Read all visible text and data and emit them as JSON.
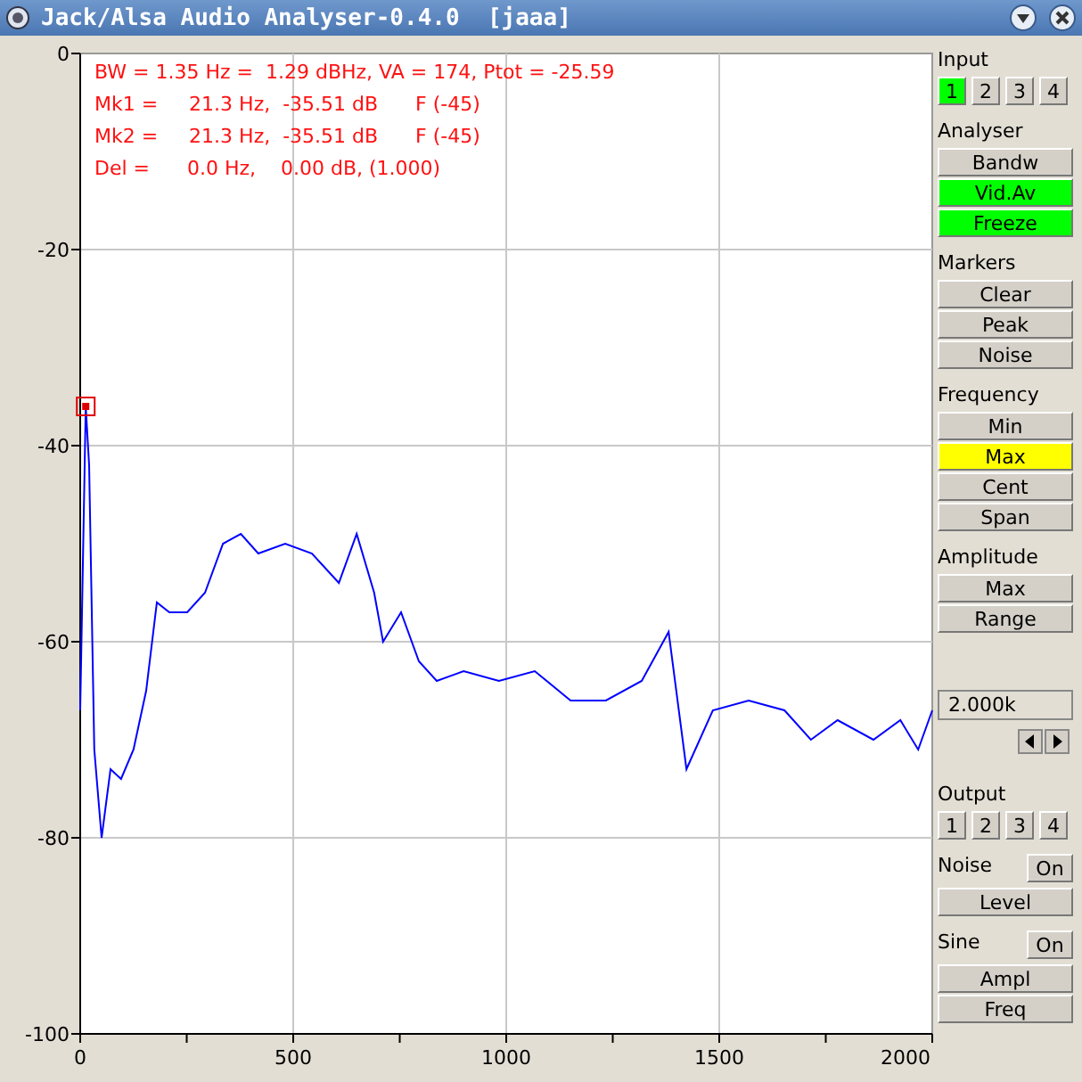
{
  "window": {
    "title": "Jack/Alsa Audio Analyser-0.4.0  [jaaa]"
  },
  "readouts": [
    "BW = 1.35 Hz =  1.29 dBHz, VA = 174, Ptot = -25.59",
    "Mk1 =     21.3 Hz,  -35.51 dB      F (-45)",
    "Mk2 =     21.3 Hz,  -35.51 dB      F (-45)",
    "Del =      0.0 Hz,    0.00 dB, (1.000)"
  ],
  "spectrum": {
    "chart_data": {
      "type": "line",
      "x": [
        0,
        13,
        21,
        33,
        50,
        71,
        96,
        125,
        155,
        180,
        209,
        251,
        293,
        335,
        377,
        418,
        481,
        544,
        607,
        649,
        690,
        711,
        753,
        795,
        837,
        900,
        983,
        1067,
        1151,
        1234,
        1318,
        1381,
        1423,
        1485,
        1569,
        1653,
        1715,
        1778,
        1862,
        1925,
        1967,
        2000
      ],
      "series": [
        {
          "color": "#0000ff",
          "values": [
            -67,
            -36,
            -42,
            -71,
            -80,
            -73,
            -74,
            -71,
            -65,
            -56,
            -57,
            -57,
            -55,
            -50,
            -49,
            -51,
            -50,
            -51,
            -54,
            -49,
            -55,
            -60,
            -57,
            -62,
            -64,
            -63,
            -64,
            -63,
            -66,
            -66,
            -64,
            -59,
            -73,
            -67,
            -66,
            -67,
            -70,
            -68,
            -70,
            -68,
            -71,
            -67
          ]
        }
      ],
      "xlim": [
        0,
        2000
      ],
      "ylim": [
        -100,
        0
      ],
      "xticks": [
        0,
        500,
        1000,
        1500,
        2000
      ],
      "yticks": [
        0,
        -20,
        -40,
        -60,
        -80,
        -100
      ],
      "grid": true
    }
  },
  "sidebar": [
    {
      "kind": "row",
      "title": "Input",
      "buttons": [
        {
          "label": "1",
          "color": "#00ff00"
        },
        {
          "label": "2",
          "color": "#d4d0c8"
        },
        {
          "label": "3",
          "color": "#d4d0c8"
        },
        {
          "label": "4",
          "color": "#d4d0c8"
        }
      ]
    },
    {
      "kind": "stack",
      "title": "Analyser",
      "buttons": [
        {
          "label": "Bandw",
          "color": "#d4d0c8"
        },
        {
          "label": "Vid.Av",
          "color": "#00ff00"
        },
        {
          "label": "Freeze",
          "color": "#00ff00"
        }
      ]
    },
    {
      "kind": "stack",
      "title": "Markers",
      "buttons": [
        {
          "label": "Clear",
          "color": "#d4d0c8"
        },
        {
          "label": "Peak",
          "color": "#d4d0c8"
        },
        {
          "label": "Noise",
          "color": "#d4d0c8"
        }
      ]
    },
    {
      "kind": "stack",
      "title": "Frequency",
      "buttons": [
        {
          "label": "Min",
          "color": "#d4d0c8"
        },
        {
          "label": "Max",
          "color": "#ffff00"
        },
        {
          "label": "Cent",
          "color": "#d4d0c8"
        },
        {
          "label": "Span",
          "color": "#d4d0c8"
        }
      ]
    },
    {
      "kind": "stack",
      "title": "Amplitude",
      "buttons": [
        {
          "label": "Max",
          "color": "#d4d0c8"
        },
        {
          "label": "Range",
          "color": "#d4d0c8"
        }
      ]
    },
    {
      "kind": "field",
      "value": "2.000k"
    },
    {
      "kind": "row",
      "title": "Output",
      "buttons": [
        {
          "label": "1",
          "color": "#d4d0c8"
        },
        {
          "label": "2",
          "color": "#d4d0c8"
        },
        {
          "label": "3",
          "color": "#d4d0c8"
        },
        {
          "label": "4",
          "color": "#d4d0c8"
        }
      ]
    },
    {
      "kind": "switch",
      "title": "Noise",
      "toggle": {
        "label": "On",
        "color": "#d4d0c8"
      },
      "buttons": [
        {
          "label": "Level",
          "color": "#d4d0c8"
        }
      ]
    },
    {
      "kind": "switch",
      "title": "Sine",
      "toggle": {
        "label": "On",
        "color": "#d4d0c8"
      },
      "buttons": [
        {
          "label": "Ampl",
          "color": "#d4d0c8"
        },
        {
          "label": "Freq",
          "color": "#d4d0c8"
        }
      ]
    }
  ]
}
